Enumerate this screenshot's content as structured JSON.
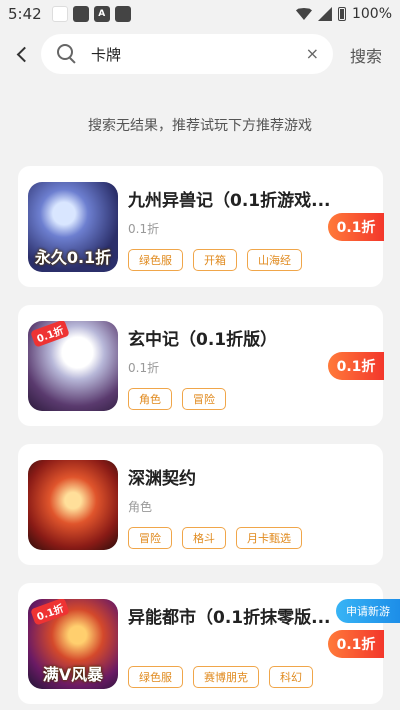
{
  "status": {
    "time": "5:42",
    "battery": "100%",
    "icon_a_letter": "A"
  },
  "search": {
    "value": "卡牌",
    "clear": "×",
    "button": "搜索"
  },
  "hint": "搜索无结果，推荐试玩下方推荐游戏",
  "games": [
    {
      "title": "九州异兽记（0.1折游戏...",
      "subtitle": "0.1折",
      "tags": [
        "绿色服",
        "开箱",
        "山海经"
      ],
      "discount": "0.1折",
      "art_label": "永久0.1折"
    },
    {
      "title": "玄中记（0.1折版）",
      "subtitle": "0.1折",
      "tags": [
        "角色",
        "冒险"
      ],
      "discount": "0.1折",
      "art_corner": "0.1折"
    },
    {
      "title": "深渊契约",
      "subtitle": "角色",
      "tags": [
        "冒险",
        "格斗",
        "月卡甄选"
      ]
    },
    {
      "title": "异能都市（0.1折抹零版...",
      "subtitle": "",
      "tags": [
        "绿色服",
        "赛博朋克",
        "科幻"
      ],
      "discount": "0.1折",
      "badge": "申请新游",
      "art_label": "满V风暴",
      "art_corner": "0.1折"
    }
  ]
}
